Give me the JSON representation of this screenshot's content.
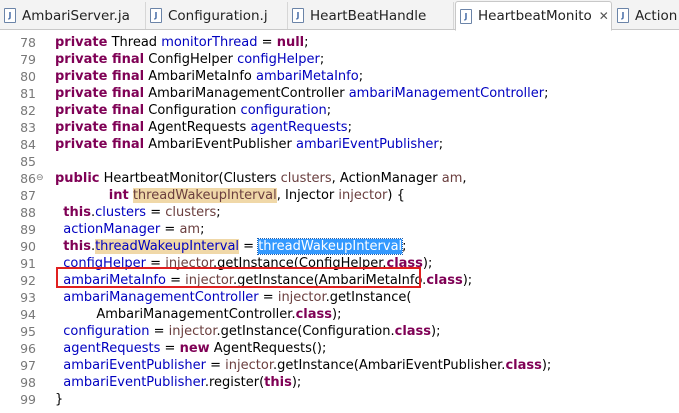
{
  "tabs": [
    {
      "label": "AmbariServer.ja",
      "active": false
    },
    {
      "label": "Configuration.j",
      "active": false
    },
    {
      "label": "HeartBeatHandle",
      "active": false
    },
    {
      "label": "HeartbeatMonito",
      "active": true
    },
    {
      "label": "Action",
      "active": false
    }
  ],
  "code": {
    "lines": [
      {
        "n": "78",
        "t": [
          [
            "kw",
            "private"
          ],
          [
            "p",
            " Thread "
          ],
          [
            "fld",
            "monitorThread"
          ],
          [
            "p",
            " = "
          ],
          [
            "kw",
            "null"
          ],
          [
            "p",
            ";"
          ]
        ]
      },
      {
        "n": "79",
        "t": [
          [
            "kw",
            "private final"
          ],
          [
            "p",
            " ConfigHelper "
          ],
          [
            "fld",
            "configHelper"
          ],
          [
            "p",
            ";"
          ]
        ]
      },
      {
        "n": "80",
        "t": [
          [
            "kw",
            "private final"
          ],
          [
            "p",
            " AmbariMetaInfo "
          ],
          [
            "fld",
            "ambariMetaInfo"
          ],
          [
            "p",
            ";"
          ]
        ]
      },
      {
        "n": "81",
        "t": [
          [
            "kw",
            "private final"
          ],
          [
            "p",
            " AmbariManagementController "
          ],
          [
            "fld",
            "ambariManagementController"
          ],
          [
            "p",
            ";"
          ]
        ]
      },
      {
        "n": "82",
        "t": [
          [
            "kw",
            "private final"
          ],
          [
            "p",
            " Configuration "
          ],
          [
            "fld",
            "configuration"
          ],
          [
            "p",
            ";"
          ]
        ]
      },
      {
        "n": "83",
        "t": [
          [
            "kw",
            "private final"
          ],
          [
            "p",
            " AgentRequests "
          ],
          [
            "fld",
            "agentRequests"
          ],
          [
            "p",
            ";"
          ]
        ]
      },
      {
        "n": "84",
        "t": [
          [
            "kw",
            "private final"
          ],
          [
            "p",
            " AmbariEventPublisher "
          ],
          [
            "fld",
            "ambariEventPublisher"
          ],
          [
            "p",
            ";"
          ]
        ]
      },
      {
        "n": "85",
        "t": []
      },
      {
        "n": "86",
        "fold": "⊖",
        "t": [
          [
            "kw",
            "public"
          ],
          [
            "p",
            " HeartbeatMonitor(Clusters "
          ],
          [
            "prm",
            "clusters"
          ],
          [
            "p",
            ", ActionManager "
          ],
          [
            "prm",
            "am"
          ],
          [
            "p",
            ","
          ]
        ]
      },
      {
        "n": "87",
        "t": [
          [
            "p",
            "             "
          ],
          [
            "kw",
            "int"
          ],
          [
            "p",
            " "
          ],
          [
            "hl-prm",
            "threadWakeupInterval"
          ],
          [
            "p",
            ", Injector "
          ],
          [
            "prm",
            "injector"
          ],
          [
            "p",
            ") {"
          ]
        ]
      },
      {
        "n": "88",
        "t": [
          [
            "p",
            "  "
          ],
          [
            "kw",
            "this"
          ],
          [
            "p",
            "."
          ],
          [
            "fld",
            "clusters"
          ],
          [
            "p",
            " = "
          ],
          [
            "prm",
            "clusters"
          ],
          [
            "p",
            ";"
          ]
        ]
      },
      {
        "n": "89",
        "t": [
          [
            "p",
            "  "
          ],
          [
            "fld",
            "actionManager"
          ],
          [
            "p",
            " = "
          ],
          [
            "prm",
            "am"
          ],
          [
            "p",
            ";"
          ]
        ]
      },
      {
        "n": "90",
        "t": [
          [
            "p",
            "  "
          ],
          [
            "kw",
            "this"
          ],
          [
            "p",
            "."
          ],
          [
            "mark",
            "threadWakeupInterval"
          ],
          [
            "p",
            " = "
          ],
          [
            "sel",
            "threadWakeupInterval"
          ],
          [
            "p",
            ";"
          ]
        ]
      },
      {
        "n": "91",
        "t": [
          [
            "p",
            "  "
          ],
          [
            "fld",
            "configHelper"
          ],
          [
            "p",
            " = "
          ],
          [
            "prm",
            "injector"
          ],
          [
            "p",
            ".getInstance(ConfigHelper."
          ],
          [
            "kw",
            "class"
          ],
          [
            "p",
            ");"
          ]
        ]
      },
      {
        "n": "92",
        "t": [
          [
            "p",
            "  "
          ],
          [
            "fld",
            "ambariMetaInfo"
          ],
          [
            "p",
            " = "
          ],
          [
            "prm",
            "injector"
          ],
          [
            "p",
            ".getInstance(AmbariMetaInfo."
          ],
          [
            "kw",
            "class"
          ],
          [
            "p",
            ");"
          ]
        ]
      },
      {
        "n": "93",
        "t": [
          [
            "p",
            "  "
          ],
          [
            "fld",
            "ambariManagementController"
          ],
          [
            "p",
            " = "
          ],
          [
            "prm",
            "injector"
          ],
          [
            "p",
            ".getInstance("
          ]
        ]
      },
      {
        "n": "94",
        "t": [
          [
            "p",
            "          AmbariManagementController."
          ],
          [
            "kw",
            "class"
          ],
          [
            "p",
            ");"
          ]
        ]
      },
      {
        "n": "95",
        "t": [
          [
            "p",
            "  "
          ],
          [
            "fld",
            "configuration"
          ],
          [
            "p",
            " = "
          ],
          [
            "prm",
            "injector"
          ],
          [
            "p",
            ".getInstance(Configuration."
          ],
          [
            "kw",
            "class"
          ],
          [
            "p",
            ");"
          ]
        ]
      },
      {
        "n": "96",
        "t": [
          [
            "p",
            "  "
          ],
          [
            "fld",
            "agentRequests"
          ],
          [
            "p",
            " = "
          ],
          [
            "kw",
            "new"
          ],
          [
            "p",
            " AgentRequests();"
          ]
        ]
      },
      {
        "n": "97",
        "t": [
          [
            "p",
            "  "
          ],
          [
            "fld",
            "ambariEventPublisher"
          ],
          [
            "p",
            " = "
          ],
          [
            "prm",
            "injector"
          ],
          [
            "p",
            ".getInstance(AmbariEventPublisher."
          ],
          [
            "kw",
            "class"
          ],
          [
            "p",
            ");"
          ]
        ]
      },
      {
        "n": "98",
        "t": [
          [
            "p",
            "  "
          ],
          [
            "fld",
            "ambariEventPublisher"
          ],
          [
            "p",
            ".register("
          ],
          [
            "kw",
            "this"
          ],
          [
            "p",
            ");"
          ]
        ]
      },
      {
        "n": "99",
        "t": [
          [
            "p",
            "}"
          ]
        ]
      }
    ]
  }
}
